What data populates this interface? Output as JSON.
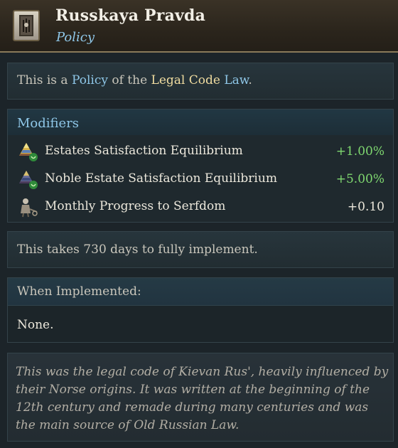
{
  "header": {
    "title": "Russkaya Pravda",
    "subtitle": "Policy",
    "icon": "law-scroll-icon"
  },
  "intro": {
    "prefix": "This is a ",
    "keyword_policy": "Policy",
    "middle": " of the ",
    "keyword_law": "Legal Code",
    "keyword_law2": " Law",
    "suffix": "."
  },
  "modifiers": {
    "title": "Modifiers",
    "items": [
      {
        "label": "Estates Satisfaction Equilibrium",
        "value": "+1.00%",
        "icon": "estates-pyramid-icon",
        "color": "#7fd870"
      },
      {
        "label": "Noble Estate Satisfaction Equilibrium",
        "value": "+5.00%",
        "icon": "noble-estate-icon",
        "color": "#7fd870"
      },
      {
        "label": "Monthly Progress to Serfdom",
        "value": "+0.10",
        "icon": "serfdom-peasant-icon",
        "color": "#ece8dc"
      }
    ]
  },
  "duration": {
    "text": "This takes 730 days to fully implement."
  },
  "implemented": {
    "title": "When Implemented:",
    "value": "None."
  },
  "flavor": {
    "text": "This was the legal code of Kievan Rus', heavily influenced by their Norse origins. It was written at the beginning of the 12th century and remade during many centuries and was the main source of Old Russian Law."
  },
  "colors": {
    "accent_blue": "#8fc7e8",
    "keyword_gold": "#f0dca0",
    "positive_green": "#7fd870"
  }
}
